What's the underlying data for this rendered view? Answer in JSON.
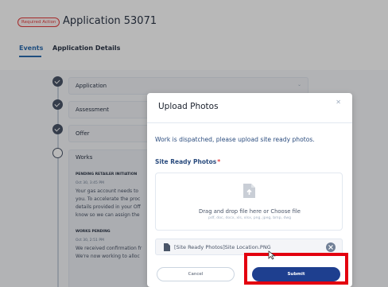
{
  "header": {
    "status_badge": "Required Action",
    "title": "Application 53071"
  },
  "tabs": [
    {
      "label": "Events"
    },
    {
      "label": "Application Details"
    }
  ],
  "timeline": {
    "steps": [
      {
        "label": "Application"
      },
      {
        "label": "Assessment"
      },
      {
        "label": "Offer"
      },
      {
        "label": "Works"
      }
    ],
    "works_events": [
      {
        "heading": "PENDING RETAILER INITIATION",
        "date": "Oct 30, 3:45 PM",
        "lines": [
          "Your gas account needs to",
          "you. To accelerate the proc",
          "details provided in your Off",
          "know so we can assign the"
        ]
      },
      {
        "heading": "WORKS PENDING",
        "date": "Oct 30, 2:51 PM",
        "lines": [
          "We received confirmation fr",
          "We're now working to alloc"
        ]
      }
    ]
  },
  "modal": {
    "title": "Upload Photos",
    "message": "Work is dispatched, please upload site ready photos.",
    "field_label": "Site Ready Photos",
    "required_mark": "*",
    "dropzone_text": "Drag and drop file here or Choose file",
    "dropzone_hint": "pdf, doc, docx, xls, xlsx, png, jpeg, bmp, dwg",
    "uploaded_file": "[Site Ready Photos]Site Location.PNG",
    "cancel_label": "Cancel",
    "submit_label": "Submit"
  },
  "colors": {
    "primary": "#1e3f8f",
    "badge": "#e53e3e",
    "highlight": "#e3000f"
  }
}
